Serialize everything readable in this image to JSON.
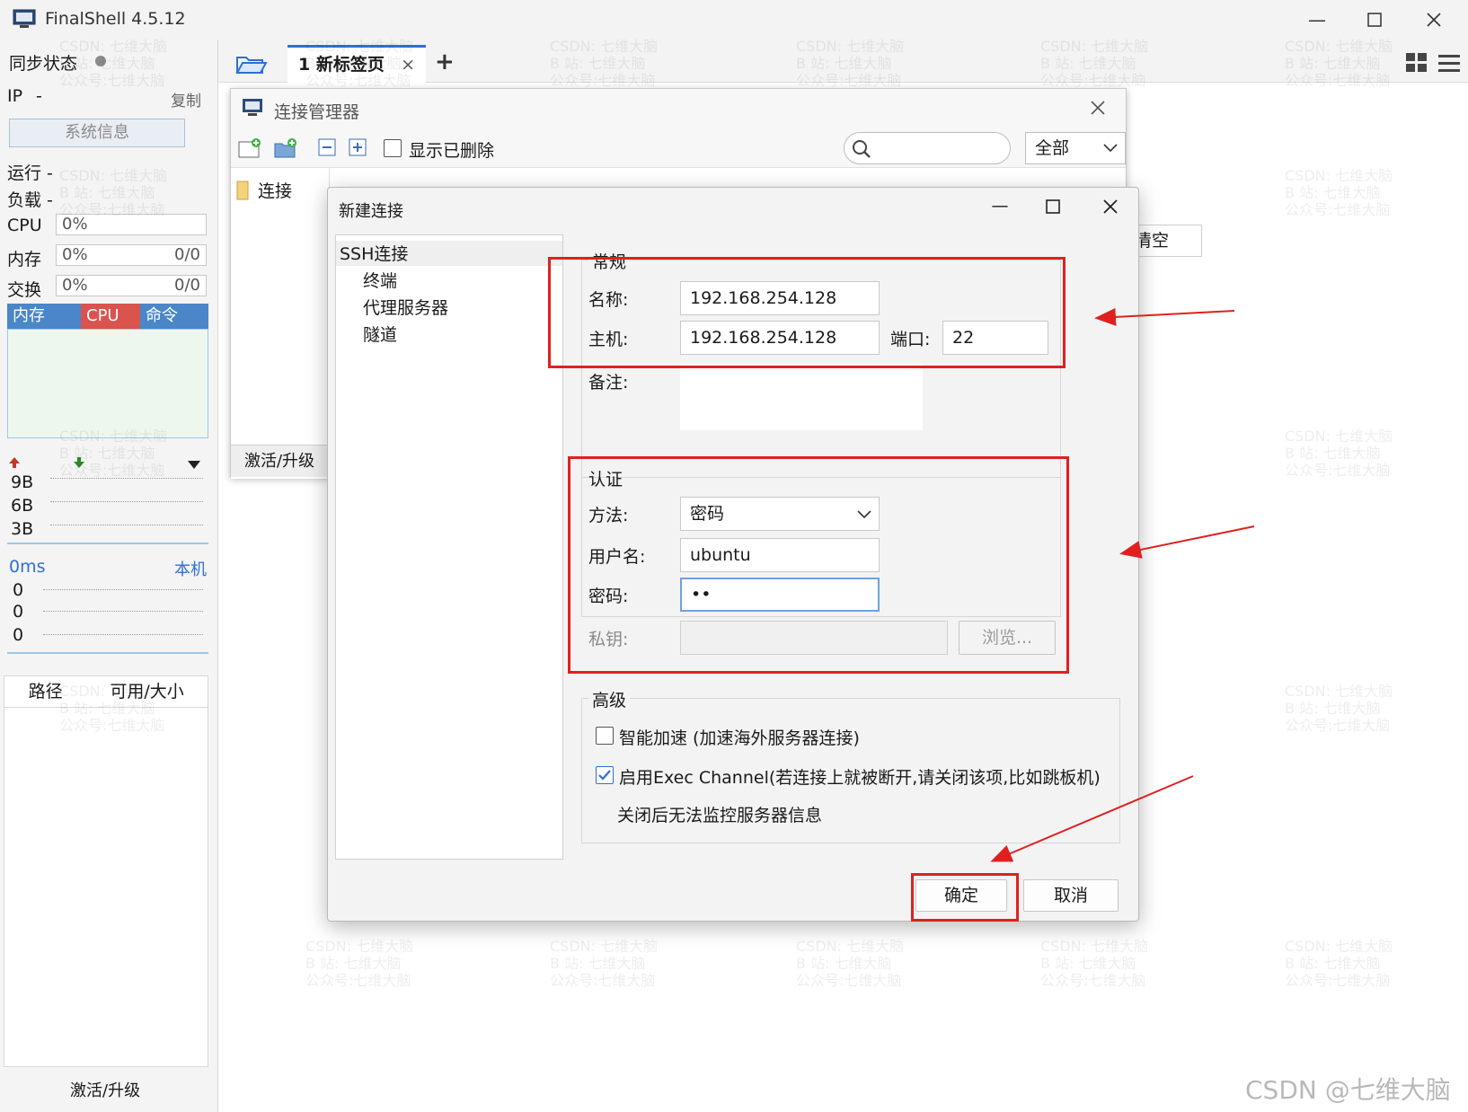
{
  "window": {
    "title": "FinalShell 4.5.12"
  },
  "sidebar": {
    "sync_label": "同步状态",
    "ip_label": "IP",
    "ip_value": "-",
    "copy_label": "复制",
    "sysinfo_label": "系统信息",
    "run_label": "运行 -",
    "load_label": "负载 -",
    "cpu_label": "CPU",
    "cpu_value": "0%",
    "mem_label": "内存",
    "mem_value": "0%",
    "mem_count": "0/0",
    "swap_label": "交换",
    "swap_value": "0%",
    "swap_count": "0/0",
    "monitor_tabs": [
      "内存",
      "CPU",
      "命令"
    ],
    "net_ticks": [
      "9B",
      "6B",
      "3B"
    ],
    "latency_value": "0ms",
    "latency_target": "本机",
    "latency_ticks": [
      "0",
      "0",
      "0"
    ],
    "disk_headers": [
      "路径",
      "可用/大小"
    ],
    "activate_label": "激活/升级"
  },
  "tabs": {
    "active_label": "1 新标签页",
    "close_glyph": "×",
    "add_glyph": "+"
  },
  "connection_manager": {
    "title": "连接管理器",
    "show_deleted_label": "显示已删除",
    "filter_value": "全部",
    "tree_item": "连接",
    "activate_label": "激活/升级",
    "clear_label": "清空"
  },
  "new_connection": {
    "title": "新建连接",
    "nav": {
      "ssh": "SSH连接",
      "terminal": "终端",
      "proxy": "代理服务器",
      "tunnel": "隧道"
    },
    "general": {
      "section": "常规",
      "name_label": "名称:",
      "name_value": "192.168.254.128",
      "host_label": "主机:",
      "host_value": "192.168.254.128",
      "port_label": "端口:",
      "port_value": "22",
      "remark_label": "备注:"
    },
    "auth": {
      "section": "认证",
      "method_label": "方法:",
      "method_value": "密码",
      "user_label": "用户名:",
      "user_value": "ubuntu",
      "password_label": "密码:",
      "password_value": "••",
      "key_label": "私钥:",
      "browse_label": "浏览..."
    },
    "advanced": {
      "section": "高级",
      "smart_accel_label": "智能加速 (加速海外服务器连接)",
      "smart_accel_checked": false,
      "exec_channel_label": "启用Exec Channel(若连接上就被断开,请关闭该项,比如跳板机)",
      "exec_channel_checked": true,
      "exec_channel_note": "关闭后无法监控服务器信息"
    },
    "ok_label": "确定",
    "cancel_label": "取消"
  },
  "watermark": {
    "lines": "CSDN: 七维大脑\nB 站: 七维大脑\n公众号:七维大脑",
    "corner": "CSDN @七维大脑"
  },
  "colors": {
    "accent": "#2f6fd6",
    "highlight_red": "#e02020",
    "tab_mem": "#4a86c8",
    "tab_cpu": "#d9534f",
    "tab_cmd": "#4a86c8"
  }
}
